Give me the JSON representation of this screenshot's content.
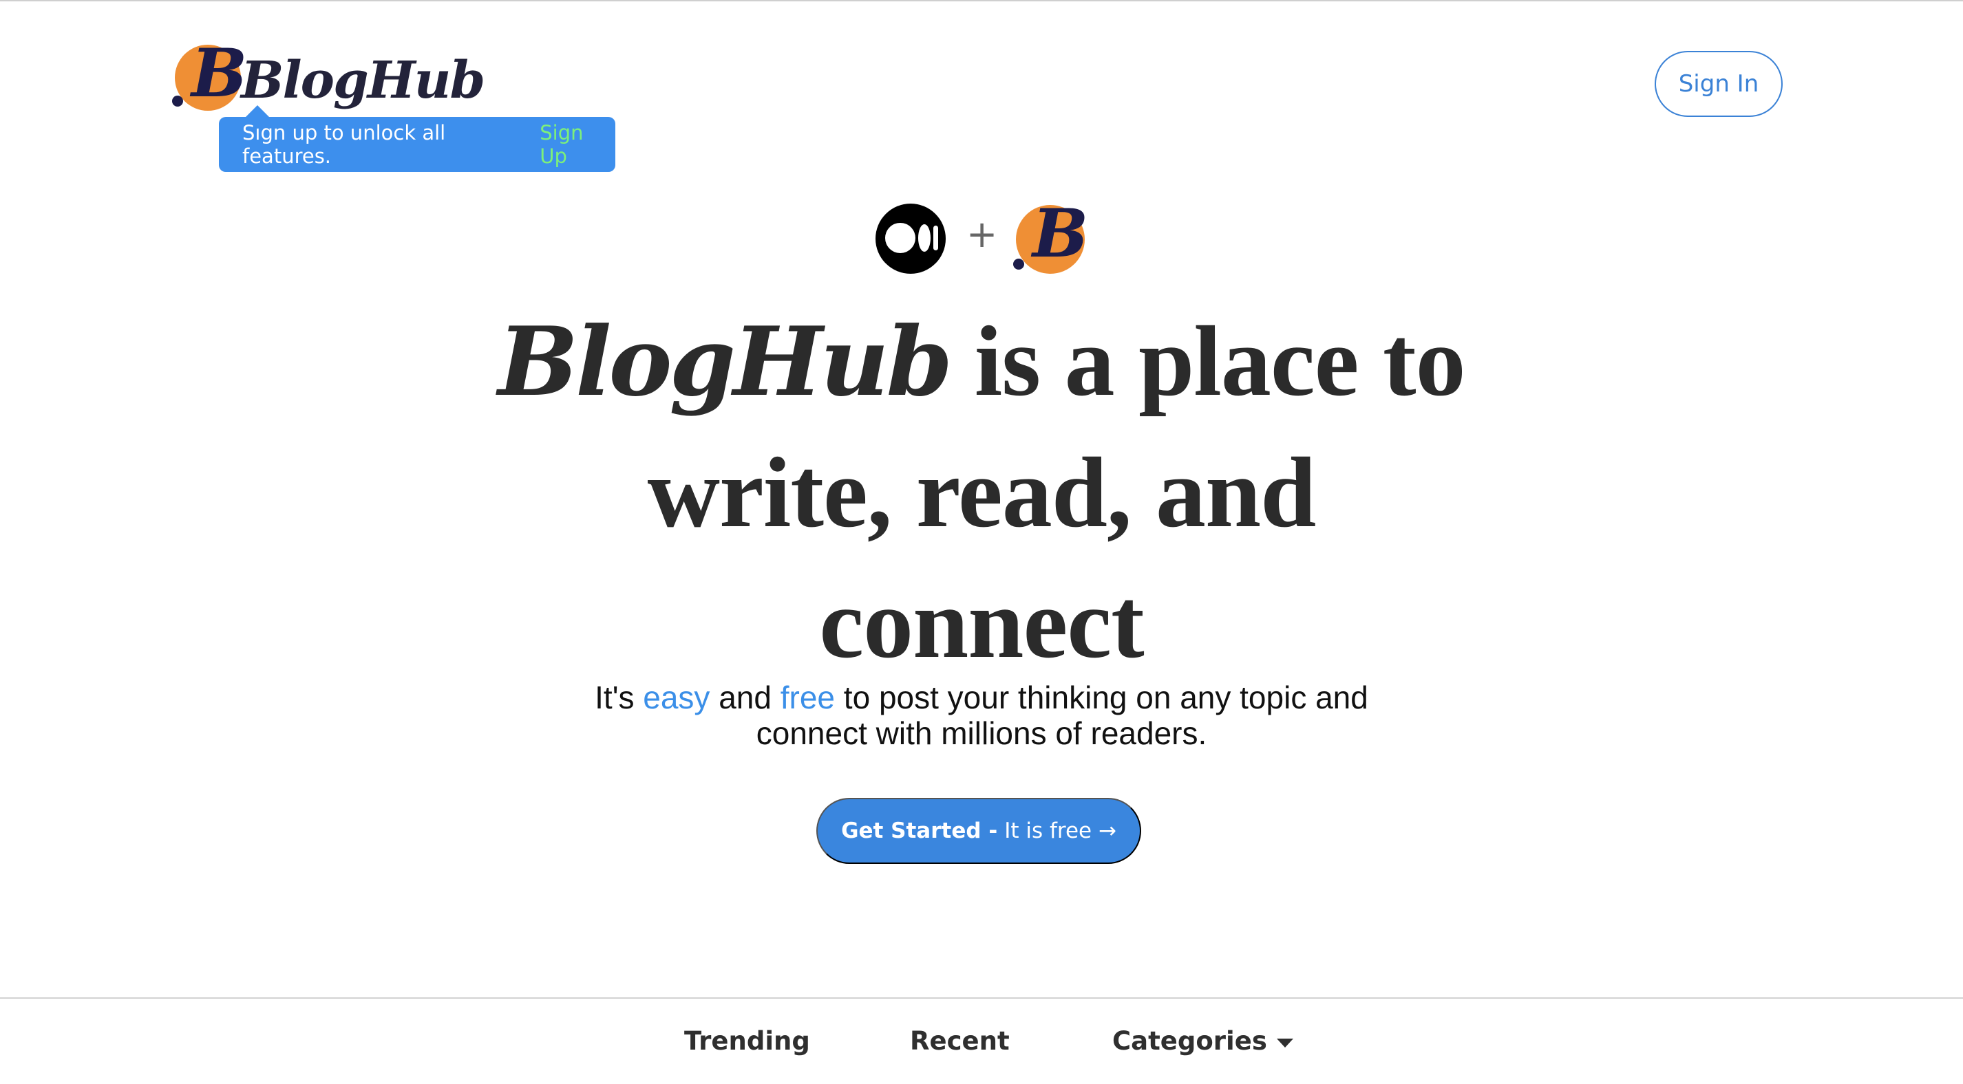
{
  "header": {
    "brand": "BlogHub",
    "sign_in_label": "Sign In"
  },
  "tooltip": {
    "text": "Sign up to unlock all features.",
    "link_label": "Sign Up"
  },
  "hero": {
    "plus_symbol": "+",
    "title_brand": "BlogHub",
    "title_rest": "is a place to write, read, and connect",
    "subtitle_part1": "It's",
    "subtitle_easy": "easy",
    "subtitle_and": "and",
    "subtitle_free": "free",
    "subtitle_part2": "to post your thinking on any topic and connect with millions of readers.",
    "cta_strong": "Get Started -",
    "cta_light": "It is free →"
  },
  "nav": {
    "trending": "Trending",
    "recent": "Recent",
    "categories": "Categories"
  },
  "colors": {
    "accent": "#3a86de",
    "brand_orange": "#ef8f35",
    "brand_navy": "#1c1c4a",
    "tooltip_link": "#7df07a"
  },
  "icons": {
    "medium": "medium-logo-icon",
    "bloghub": "bloghub-logo-icon",
    "categories_caret": "caret-down-icon"
  }
}
